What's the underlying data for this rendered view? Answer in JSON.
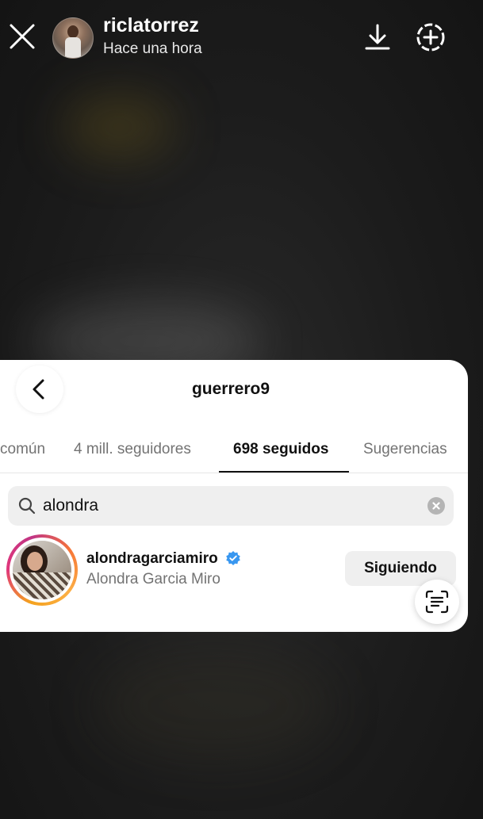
{
  "story": {
    "username": "riclatorrez",
    "time": "Hace una hora"
  },
  "panel": {
    "title": "guerrero9",
    "tabs": [
      {
        "label": "común",
        "active": false
      },
      {
        "label": "4 mill. seguidores",
        "active": false
      },
      {
        "label": "698 seguidos",
        "active": true
      },
      {
        "label": "Sugerencias",
        "active": false
      }
    ],
    "search": {
      "value": "alondra"
    },
    "results": [
      {
        "username": "alondragarciamiro",
        "verified": true,
        "full_name": "Alondra Garcia Miro",
        "button_label": "Siguiendo"
      }
    ]
  },
  "colors": {
    "verified_blue": "#3897f0",
    "secondary_text": "#737373",
    "story_ring": [
      "#f4a21e",
      "#e0367b",
      "#c13584"
    ]
  }
}
